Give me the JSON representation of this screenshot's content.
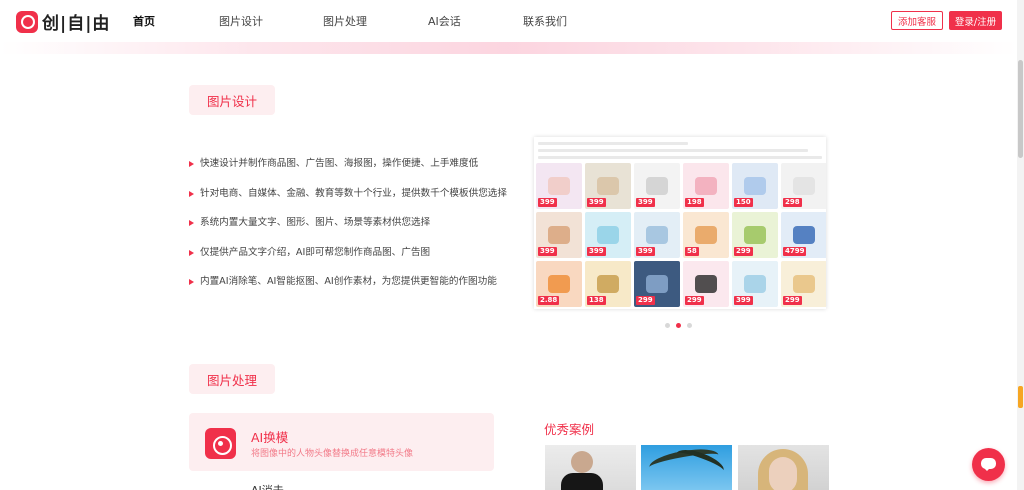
{
  "header": {
    "logo_text": "创|自|由",
    "nav": [
      "首页",
      "图片设计",
      "图片处理",
      "AI会话",
      "联系我们"
    ],
    "add_service_label": "添加客服",
    "login_label": "登录/注册"
  },
  "design_section": {
    "title": "图片设计",
    "features": [
      "快速设计并制作商品图、广告图、海报图，操作便捷、上手难度低",
      "针对电商、自媒体、金融、教育等数十个行业，提供数千个模板供您选择",
      "系统内置大量文字、图形、图片、场景等素材供您选择",
      "仅提供产品文字介绍，AI即可帮您制作商品图、广告图",
      "内置AI消除笔、AI智能抠图、AI创作素材，为您提供更智能的作图功能"
    ],
    "carousel_pages": 3,
    "carousel_active": 2
  },
  "processing_section": {
    "title": "图片处理",
    "ai_card": {
      "title": "AI换模",
      "description": "将图像中的人物头像替换成任意模特头像"
    },
    "next_item": "AI消去",
    "cases_title": "优秀案例"
  },
  "collage_tiles": [
    {
      "bg": "#f3e6f2",
      "prod": "#f0c9c3",
      "price": "399"
    },
    {
      "bg": "#e8e2d5",
      "prod": "#d8c2a3",
      "price": "399"
    },
    {
      "bg": "#f3f3f3",
      "prod": "#cfcfcf",
      "price": "399"
    },
    {
      "bg": "#fbe6ec",
      "prod": "#f1a8b8",
      "price": "198"
    },
    {
      "bg": "#dfe9f5",
      "prod": "#a8c6ea",
      "price": "150"
    },
    {
      "bg": "#f2f2f2",
      "prod": "#e2e2e2",
      "price": "298"
    },
    {
      "bg": "#f2e2d6",
      "prod": "#d9a47c",
      "price": "399"
    },
    {
      "bg": "#d5eef6",
      "prod": "#8fd0e6",
      "price": "399"
    },
    {
      "bg": "#e3eef6",
      "prod": "#9dc0dd",
      "price": "399"
    },
    {
      "bg": "#fae7d2",
      "prod": "#e6a05a",
      "price": "58"
    },
    {
      "bg": "#eaf3d6",
      "prod": "#9bc35b",
      "price": "299"
    },
    {
      "bg": "#e2ecf7",
      "prod": "#3c6fb8",
      "price": "4799"
    },
    {
      "bg": "#f9d8c0",
      "prod": "#f0903c",
      "price": "2.88"
    },
    {
      "bg": "#f7e9c8",
      "prod": "#c9a050",
      "price": "138"
    },
    {
      "bg": "#3d5a80",
      "prod": "#89a9cf",
      "price": "299"
    },
    {
      "bg": "#fbe8ee",
      "prod": "#333333",
      "price": "299"
    },
    {
      "bg": "#e7f2f8",
      "prod": "#9fcfe6",
      "price": "399"
    },
    {
      "bg": "#f8efd9",
      "prod": "#e7c17f",
      "price": "299"
    }
  ]
}
